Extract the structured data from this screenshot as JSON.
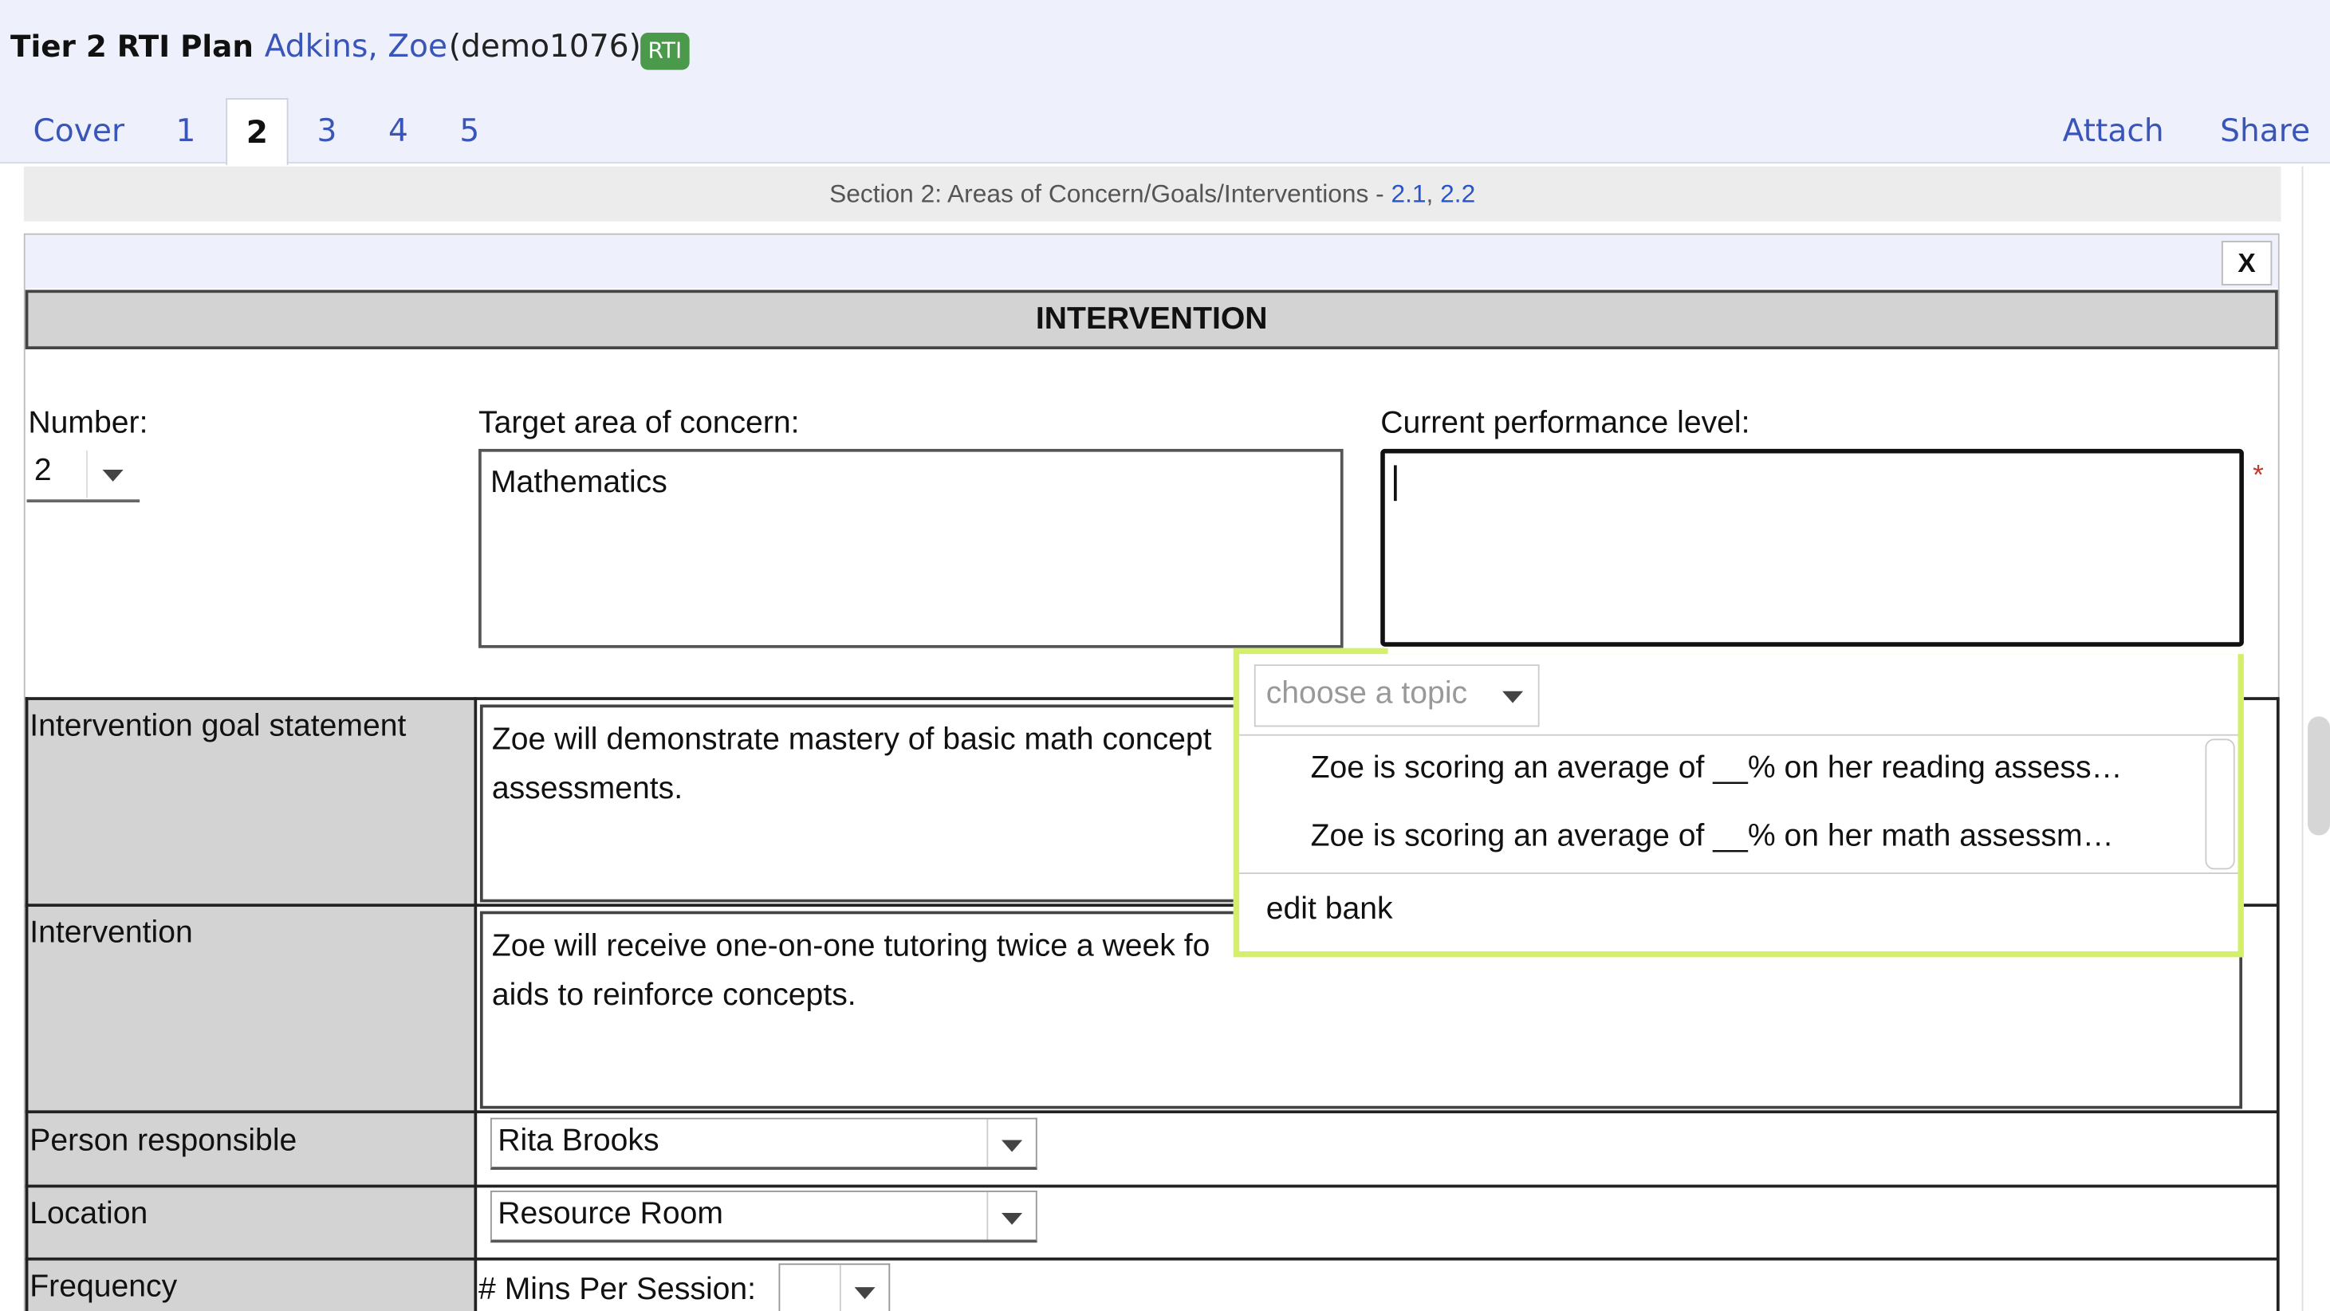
{
  "header": {
    "title": "Tier 2 RTI Plan",
    "student_name": "Adkins, Zoe",
    "student_id": "(demo1076)",
    "badge": "RTI",
    "tabs": [
      {
        "label": "Cover"
      },
      {
        "label": "1"
      },
      {
        "label": "2",
        "active": true
      },
      {
        "label": "3"
      },
      {
        "label": "4"
      },
      {
        "label": "5"
      }
    ],
    "attach_label": "Attach",
    "share_label": "Share"
  },
  "section_bar": {
    "text": "Section 2: Areas of Concern/Goals/Interventions - ",
    "link1": "2.1",
    "separator": ", ",
    "link2": "2.2"
  },
  "panel": {
    "close_label": "X",
    "title": "INTERVENTION",
    "number_label": "Number:",
    "number_value": "2",
    "target_label": "Target area of concern:",
    "target_value": "Mathematics",
    "performance_label": "Current performance level:",
    "performance_value": "",
    "required_marker": "*"
  },
  "rows": {
    "goal": {
      "label": "Intervention goal statement",
      "line1": "Zoe will demonstrate mastery of basic math concept",
      "line2": "assessments."
    },
    "intervention": {
      "label": "Intervention",
      "line1": "Zoe will receive one-on-one tutoring twice a week fo",
      "line2": "aids to reinforce concepts."
    },
    "person": {
      "label": "Person responsible",
      "value": "Rita Brooks"
    },
    "location": {
      "label": "Location",
      "value": "Resource Room"
    },
    "frequency": {
      "label": "Frequency",
      "mins_label": "# Mins Per Session:",
      "mins_value": ""
    }
  },
  "popup": {
    "topic_placeholder": "choose a topic",
    "options": [
      "Zoe is scoring an average of __% on her reading assess…",
      "Zoe is scoring an average of __% on her math assessm…"
    ],
    "edit_bank": "edit bank"
  },
  "colors": {
    "link": "#3a55b8",
    "badge": "#4b9a4b",
    "popup_border": "#d4f06b",
    "required": "#c0392b"
  }
}
